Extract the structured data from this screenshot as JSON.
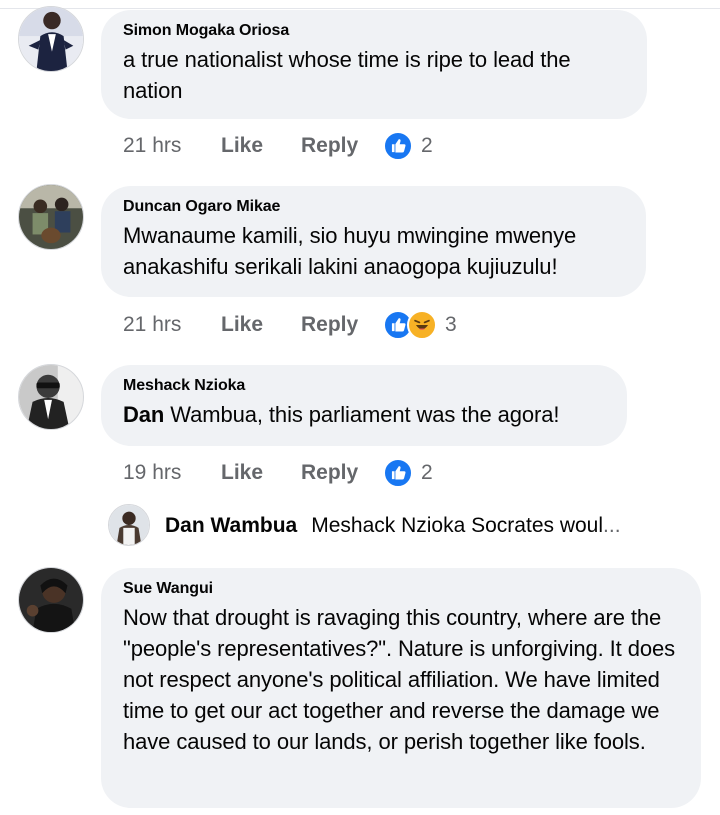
{
  "comments": [
    {
      "author": "Simon Mogaka Oriosa",
      "text": "a true nationalist whose time is ripe to lead the nation",
      "time": "21 hrs",
      "like_label": "Like",
      "reply_label": "Reply",
      "reaction_count": "2",
      "reactions": [
        "like-icon"
      ]
    },
    {
      "author": "Duncan Ogaro Mikae",
      "text": "Mwanaume kamili, sio huyu mwingine mwenye anakashifu serikali lakini anaogopa kujiuzulu!",
      "time": "21 hrs",
      "like_label": "Like",
      "reply_label": "Reply",
      "reaction_count": "3",
      "reactions": [
        "like-icon",
        "haha-icon"
      ]
    },
    {
      "author": "Meshack Nzioka",
      "mention": "Dan",
      "text": " Wambua, this parliament was the agora!",
      "time": "19 hrs",
      "like_label": "Like",
      "reply_label": "Reply",
      "reaction_count": "2",
      "reactions": [
        "like-icon"
      ]
    },
    {
      "author": "Sue Wangui",
      "text": "Now that drought is ravaging this country, where are the \"people's representatives?\". Nature is unforgiving. It does not respect anyone's political affiliation. We have limited time to get our act together and reverse the damage we have caused to our lands, or perish together like fools."
    }
  ],
  "reply_preview": {
    "author": "Dan Wambua",
    "text": "Meshack Nzioka Socrates woul",
    "ellipsis": "..."
  },
  "colors": {
    "bubble": "#f0f2f5",
    "meta_text": "#65676b",
    "like_blue": "#1877f2",
    "haha_yellow": "#f7b125"
  }
}
